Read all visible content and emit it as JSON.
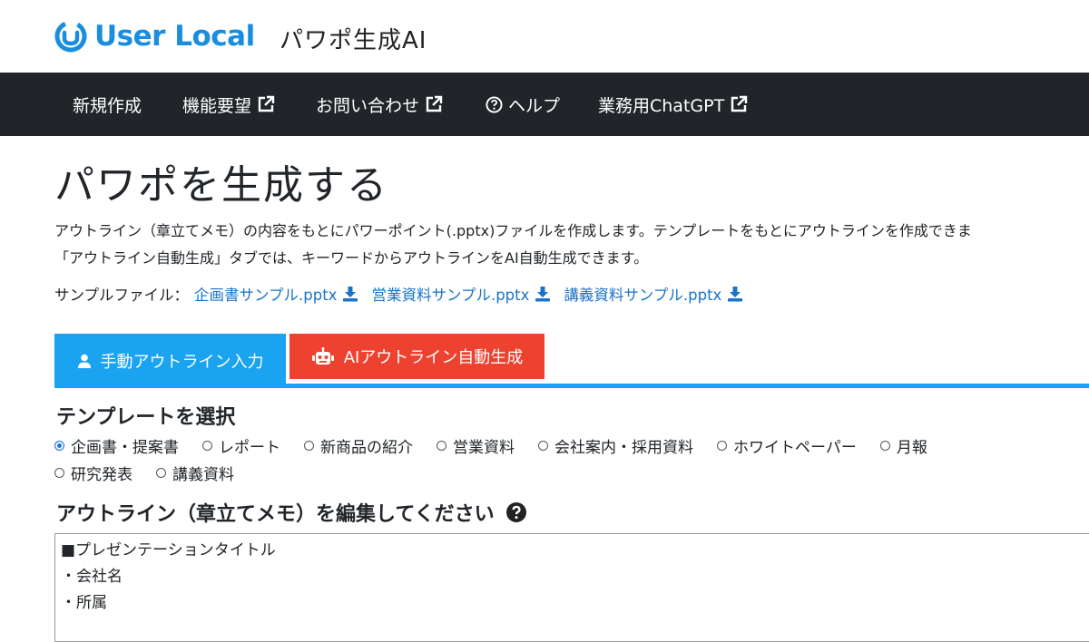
{
  "header": {
    "logo_text": "User Local",
    "product_name": "パワポ生成AI",
    "brand_color": "#1a8ede"
  },
  "nav": {
    "items": [
      {
        "label": "新規作成",
        "icon": ""
      },
      {
        "label": "機能要望",
        "icon": "external-link-icon"
      },
      {
        "label": "お問い合わせ",
        "icon": "external-link-icon"
      },
      {
        "label": "ヘルプ",
        "icon": "question-circle-icon"
      },
      {
        "label": "業務用ChatGPT",
        "icon": "external-link-icon"
      }
    ]
  },
  "main": {
    "title": "パワポを生成する",
    "description_line1": "アウトライン（章立てメモ）の内容をもとにパワーポイント(.pptx)ファイルを作成します。テンプレートをもとにアウトラインを作成できま",
    "description_line2": "「アウトライン自動生成」タブでは、キーワードからアウトラインをAI自動生成できます。",
    "samples": {
      "label": "サンプルファイル：",
      "links": [
        "企画書サンプル.pptx",
        "営業資料サンプル.pptx",
        "講義資料サンプル.pptx"
      ],
      "icon": "download-icon"
    },
    "tabs": [
      {
        "label": "手動アウトライン入力",
        "icon": "user-icon",
        "color": "#1aa3f0",
        "active": true
      },
      {
        "label": "AIアウトライン自動生成",
        "icon": "robot-icon",
        "color": "#ee4230",
        "active": false
      }
    ],
    "template_section": {
      "title": "テンプレートを選択",
      "selected": "企画書・提案書",
      "options_row1": [
        "企画書・提案書",
        "レポート",
        "新商品の紹介",
        "営業資料",
        "会社案内・採用資料",
        "ホワイトペーパー",
        "月報"
      ],
      "options_row2": [
        "研究発表",
        "講義資料"
      ]
    },
    "outline_section": {
      "title": "アウトライン（章立てメモ）を編集してください",
      "help_icon": "question-circle-icon",
      "lines": [
        "■プレゼンテーションタイトル",
        "・会社名",
        "・所属"
      ]
    }
  }
}
